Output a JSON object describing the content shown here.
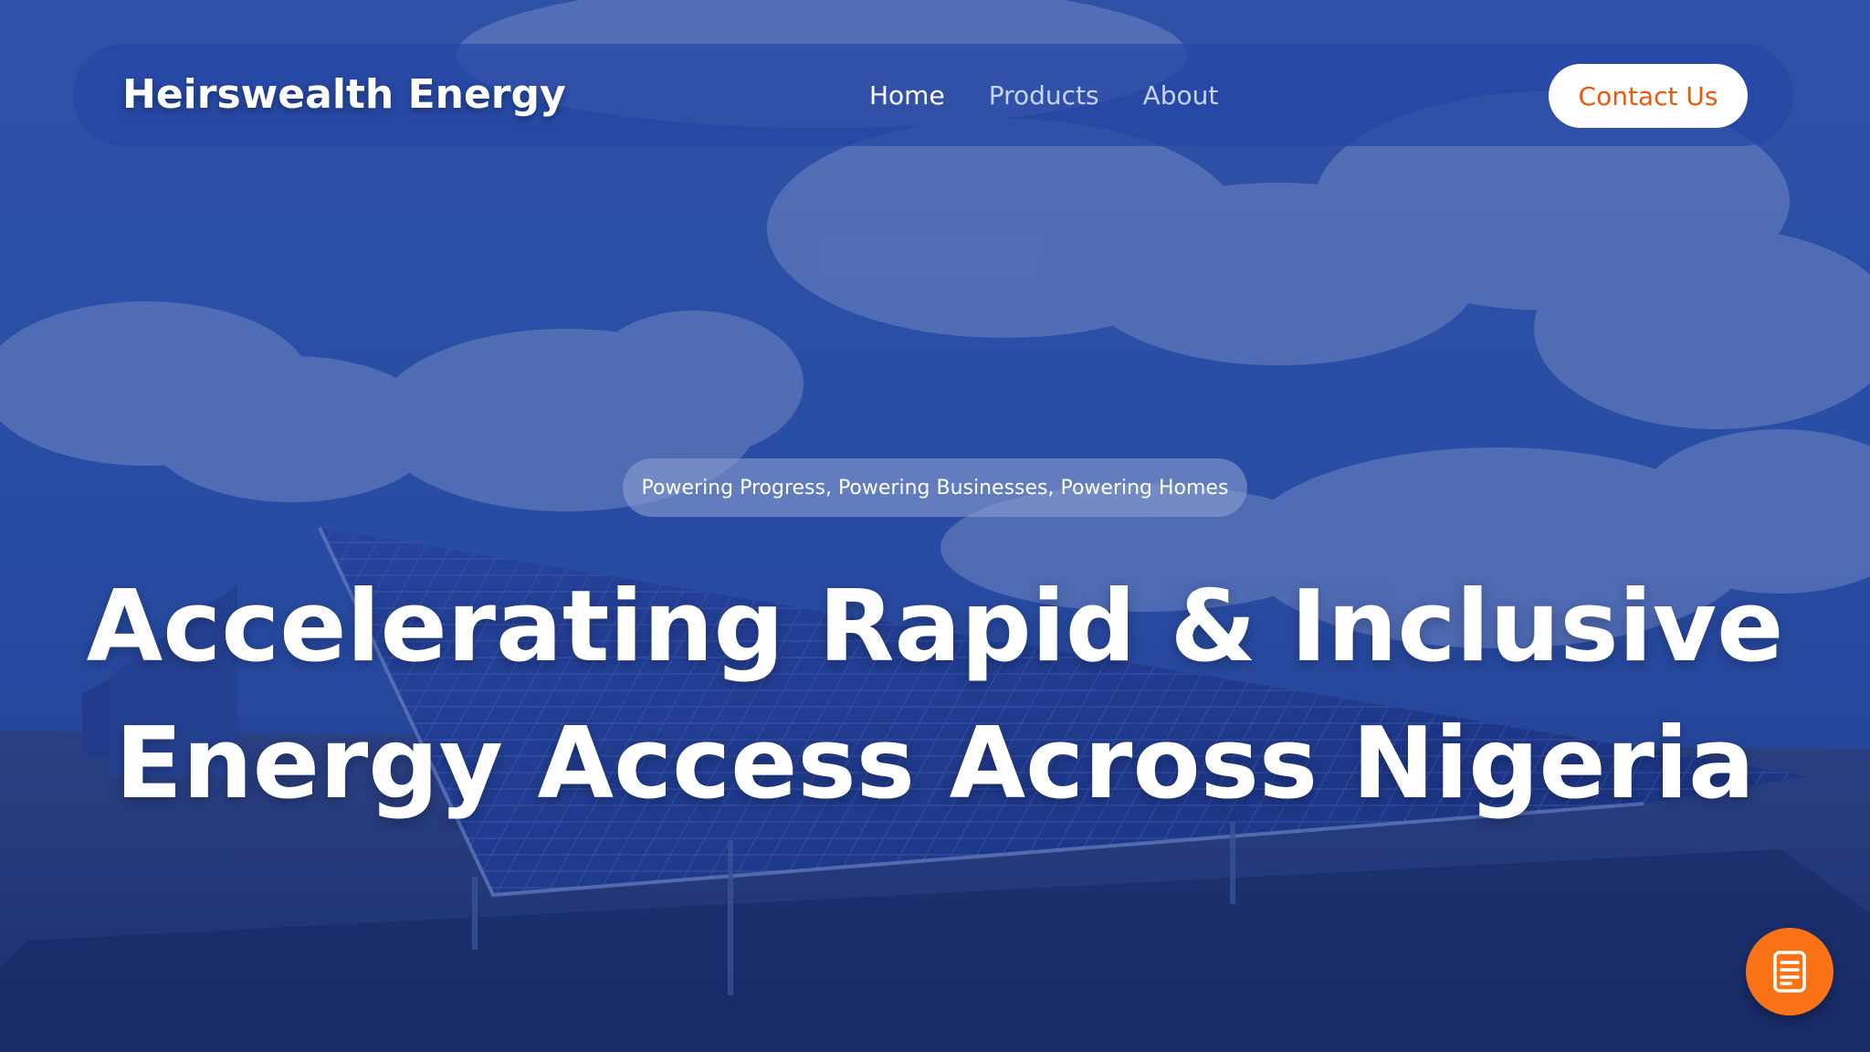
{
  "header": {
    "brand": "Heirswealth Energy",
    "nav": [
      {
        "label": "Home",
        "active": true
      },
      {
        "label": "Products",
        "active": false
      },
      {
        "label": "About",
        "active": false
      }
    ],
    "cta_label": "Contact Us"
  },
  "hero": {
    "tagline": "Powering Progress, Powering Businesses, Powering Homes",
    "headline_line1": "Accelerating Rapid & Inclusive",
    "headline_line2": "Energy Access Across Nigeria",
    "background": "solar-panel-field-photo"
  },
  "floating_action": {
    "icon": "document-icon"
  },
  "colors": {
    "accent": "#f97316",
    "cta_text": "#ea580c",
    "overlay": "#1e3a8a",
    "text": "#ffffff"
  }
}
